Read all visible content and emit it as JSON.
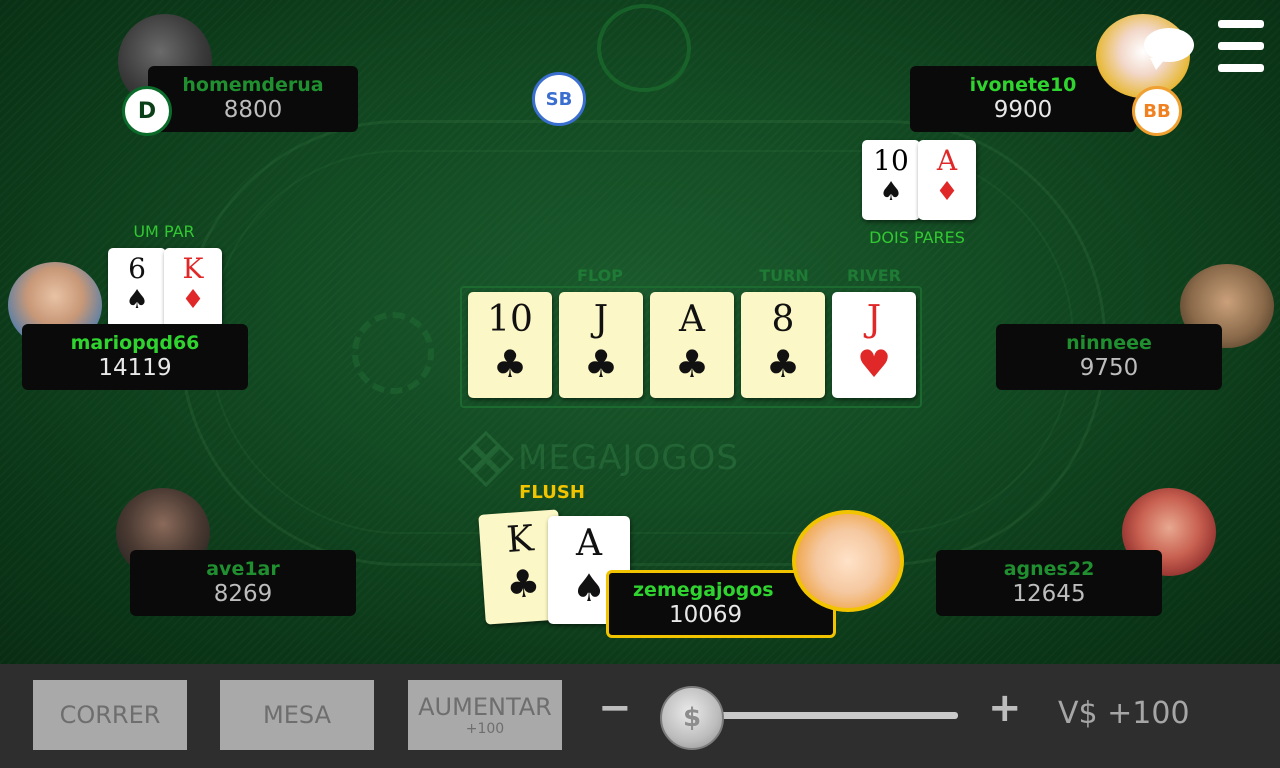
{
  "table": {
    "watermark": "MEGAJOGOS"
  },
  "players": {
    "homemderua": {
      "name": "homemderua",
      "stack": "8800"
    },
    "ivonete10": {
      "name": "ivonete10",
      "stack": "9900",
      "hand_label": "DOIS PARES"
    },
    "mariopqd66": {
      "name": "mariopqd66",
      "stack": "14119",
      "hand_label": "UM PAR"
    },
    "ninneee": {
      "name": "ninneee",
      "stack": "9750"
    },
    "ave1ar": {
      "name": "ave1ar",
      "stack": "8269"
    },
    "agnes22": {
      "name": "agnes22",
      "stack": "12645"
    },
    "zemegajogos": {
      "name": "zemegajogos",
      "stack": "10069",
      "hand_label": "FLUSH"
    }
  },
  "markers": {
    "dealer": "D",
    "small_blind": "SB",
    "big_blind": "BB"
  },
  "cards": {
    "ivonete10": [
      {
        "rank": "10",
        "suit": "♠",
        "color": "black"
      },
      {
        "rank": "A",
        "suit": "♦",
        "color": "red"
      }
    ],
    "mariopqd66": [
      {
        "rank": "6",
        "suit": "♠",
        "color": "black"
      },
      {
        "rank": "K",
        "suit": "♦",
        "color": "red"
      }
    ],
    "zemegajogos": [
      {
        "rank": "K",
        "suit": "♣",
        "color": "black"
      },
      {
        "rank": "A",
        "suit": "♠",
        "color": "black"
      }
    ],
    "board": [
      {
        "rank": "10",
        "suit": "♣",
        "color": "black",
        "highlight": true
      },
      {
        "rank": "J",
        "suit": "♣",
        "color": "black",
        "highlight": true
      },
      {
        "rank": "A",
        "suit": "♣",
        "color": "black",
        "highlight": true
      },
      {
        "rank": "8",
        "suit": "♣",
        "color": "black",
        "highlight": true
      },
      {
        "rank": "J",
        "suit": "♥",
        "color": "red",
        "highlight": false
      }
    ]
  },
  "streets": {
    "flop": "FLOP",
    "turn": "TURN",
    "river": "RIVER"
  },
  "controls": {
    "fold_label": "CORRER",
    "call_label": "MESA",
    "raise_label": "AUMENTAR",
    "raise_sub": "+100",
    "minus": "−",
    "plus": "+",
    "slider_symbol": "$",
    "slider_level": 0,
    "bet_value": "V$ +100"
  },
  "icons": {
    "menu": "menu-icon",
    "chat": "chat-bubble-icon"
  },
  "colors": {
    "felt": "#124a22",
    "name_green": "#2fd42f",
    "highlight_gold": "#f2c400",
    "button_gray": "#a9a9a9"
  }
}
